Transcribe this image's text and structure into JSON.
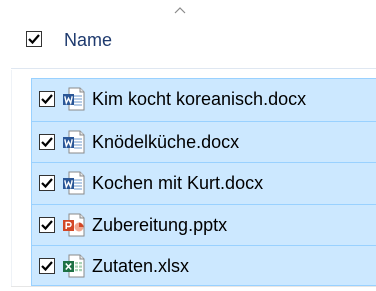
{
  "header": {
    "column_label": "Name",
    "select_all_checked": true,
    "sort_indicator": "sort-ascending-icon"
  },
  "files": [
    {
      "name": "Kim kocht koreanisch.docx",
      "type": "word",
      "icon": "word-document-icon",
      "checked": true
    },
    {
      "name": "Knödelküche.docx",
      "type": "word",
      "icon": "word-document-icon",
      "checked": true
    },
    {
      "name": "Kochen mit Kurt.docx",
      "type": "word",
      "icon": "word-document-icon",
      "checked": true
    },
    {
      "name": "Zubereitung.pptx",
      "type": "powerpoint",
      "icon": "powerpoint-document-icon",
      "checked": true
    },
    {
      "name": "Zutaten.xlsx",
      "type": "excel",
      "icon": "excel-document-icon",
      "checked": true
    }
  ],
  "colors": {
    "selection_fill": "#cce8ff",
    "selection_border": "#99d1ff",
    "header_text": "#1e3a6e",
    "word": "#2b5797",
    "powerpoint": "#d24726",
    "excel": "#1e7145"
  }
}
